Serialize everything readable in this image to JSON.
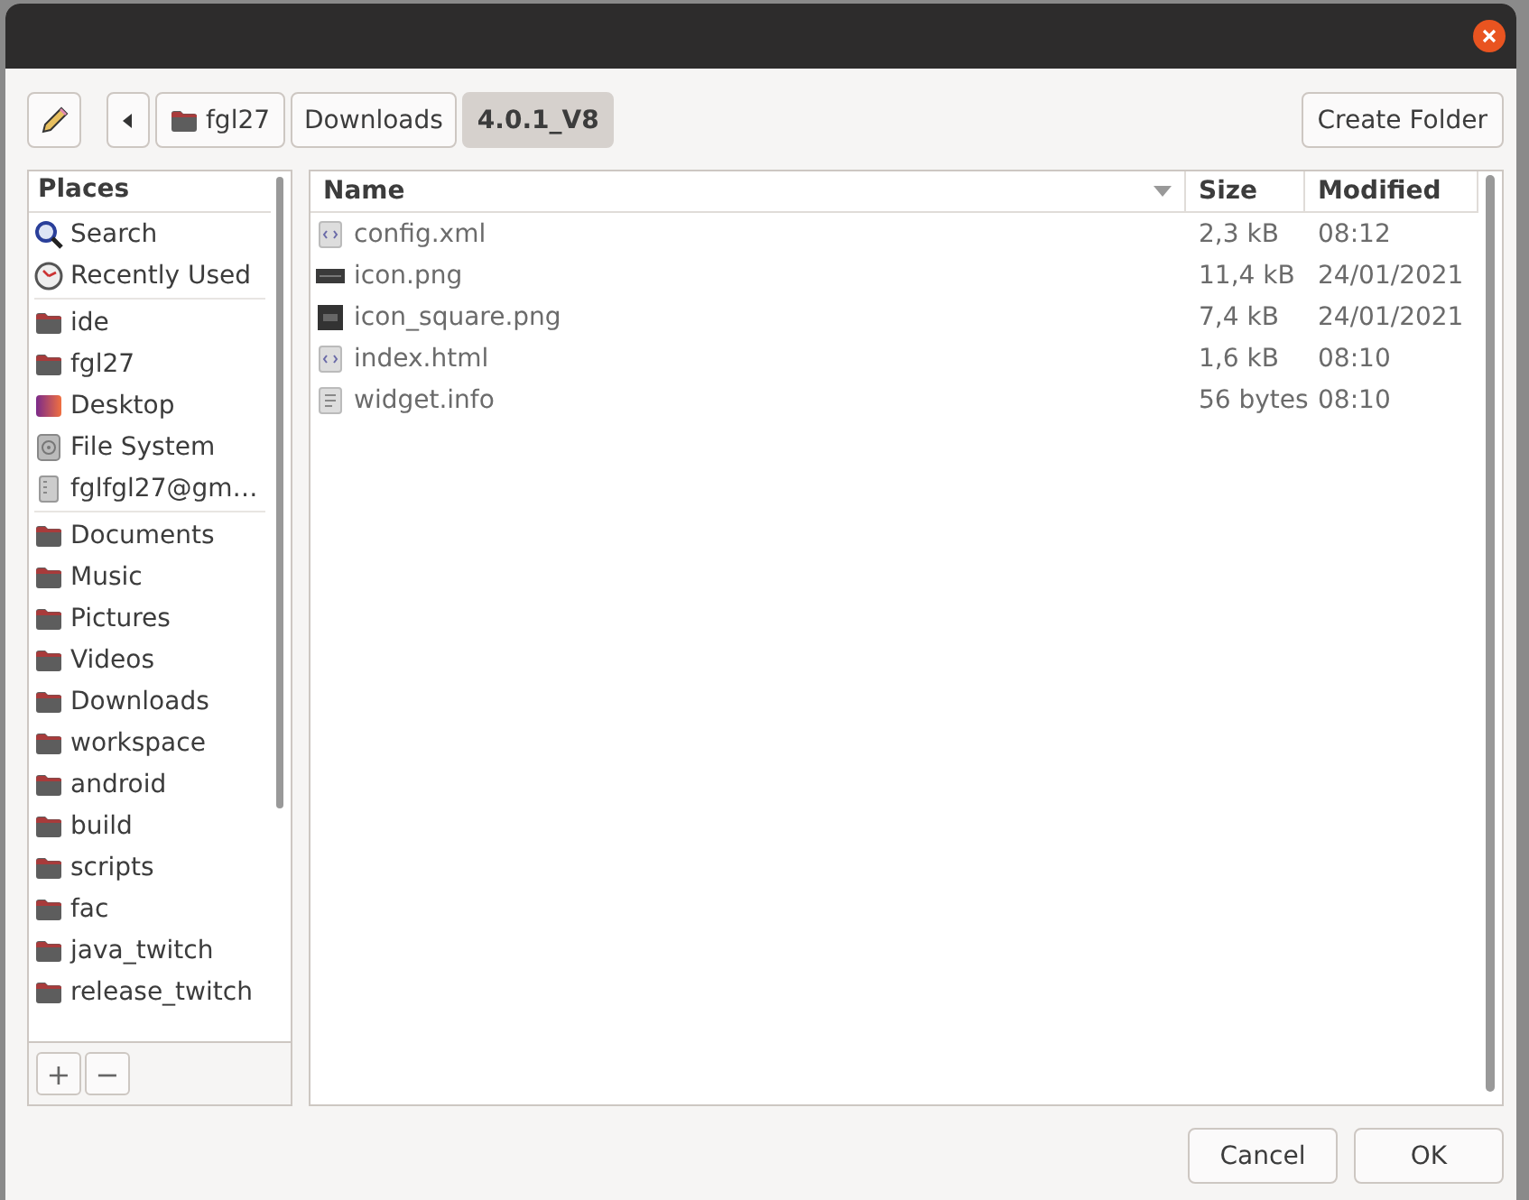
{
  "path_bar": {
    "segments": [
      {
        "label": "fgl27",
        "kind": "home",
        "selected": false
      },
      {
        "label": "Downloads",
        "kind": "plain",
        "selected": false
      },
      {
        "label": "4.0.1_V8",
        "kind": "plain",
        "selected": true
      }
    ]
  },
  "create_folder": "Create Folder",
  "places": {
    "title": "Places",
    "sections": [
      [
        {
          "label": "Search",
          "kind": "search"
        },
        {
          "label": "Recently Used",
          "kind": "recent"
        }
      ],
      [
        {
          "label": "ide",
          "kind": "folder"
        },
        {
          "label": "fgl27",
          "kind": "folder"
        },
        {
          "label": "Desktop",
          "kind": "desktop"
        },
        {
          "label": "File System",
          "kind": "disk"
        },
        {
          "label": "fglfgl27@gm…",
          "kind": "remote"
        }
      ],
      [
        {
          "label": "Documents",
          "kind": "folder"
        },
        {
          "label": "Music",
          "kind": "folder"
        },
        {
          "label": "Pictures",
          "kind": "folder"
        },
        {
          "label": "Videos",
          "kind": "folder"
        },
        {
          "label": "Downloads",
          "kind": "folder"
        },
        {
          "label": "workspace",
          "kind": "folder"
        },
        {
          "label": "android",
          "kind": "folder"
        },
        {
          "label": "build",
          "kind": "folder"
        },
        {
          "label": "scripts",
          "kind": "folder"
        },
        {
          "label": "fac",
          "kind": "folder"
        },
        {
          "label": "java_twitch",
          "kind": "folder"
        },
        {
          "label": "release_twitch",
          "kind": "folder"
        }
      ]
    ],
    "add": "+",
    "remove": "−"
  },
  "files": {
    "columns": [
      "Name",
      "Size",
      "Modified"
    ],
    "rows": [
      {
        "name": "config.xml",
        "kind": "code",
        "size": "2,3 kB",
        "modified": "08:12"
      },
      {
        "name": "icon.png",
        "kind": "image",
        "size": "11,4 kB",
        "modified": "24/01/2021"
      },
      {
        "name": "icon_square.png",
        "kind": "image-square",
        "size": "7,4 kB",
        "modified": "24/01/2021"
      },
      {
        "name": "index.html",
        "kind": "code",
        "size": "1,6 kB",
        "modified": "08:10"
      },
      {
        "name": "widget.info",
        "kind": "text",
        "size": "56 bytes",
        "modified": "08:10"
      }
    ]
  },
  "buttons": [
    "Cancel",
    "OK"
  ]
}
